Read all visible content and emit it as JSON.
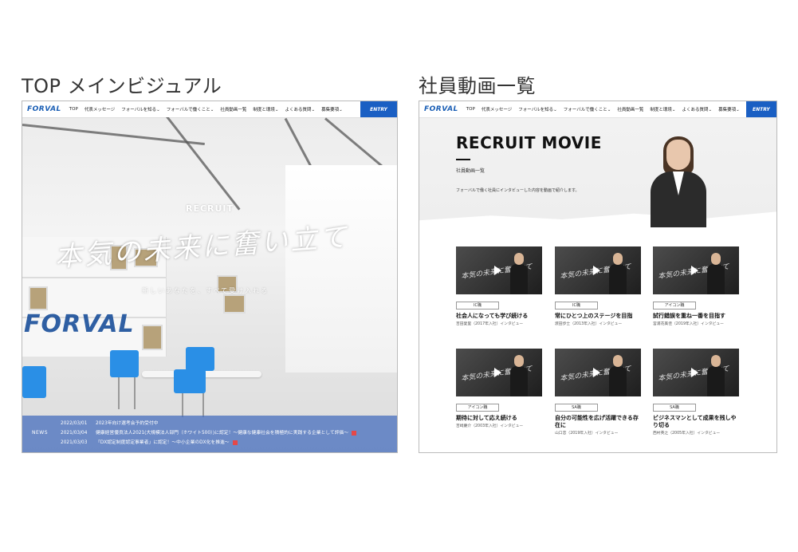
{
  "captions": {
    "left": "TOP メインビジュアル",
    "right": "社員動画一覧"
  },
  "nav": {
    "logo": "FORVAL",
    "items": [
      "TOP",
      "代表メッセージ",
      "フォーバルを知る",
      "フォーバルで働くこと",
      "社員動画一覧",
      "制度と環境",
      "よくある質問",
      "募集要項"
    ],
    "items_right": [
      "TOP",
      "代表メッセージ",
      "フォーバルを知る",
      "フォーバルで働くこと",
      "社員動画一覧",
      "制度と環境",
      "よくある質問",
      "募集要項"
    ],
    "entry": "ENTRY"
  },
  "hero": {
    "title": "RECRUIT",
    "slogan": "本気の未来に奮い立て",
    "sub": "新しいあなたを、すべて受け入れる",
    "wall_logo": "FORVAL"
  },
  "news": {
    "label": "NEWS",
    "items": [
      {
        "date": "2022/03/01",
        "text": "2023年向け選考会予約受付中",
        "pdf": false
      },
      {
        "date": "2021/03/04",
        "text": "健康経営優良法人2021(大規模法人部門（ホワイト500）)に認定！～健康な健康社会を積極的に実践する企業として評価～",
        "pdf": true
      },
      {
        "date": "2021/03/03",
        "text": "「DX認定制度認定事業者」に認定！～中小企業のDX化を推進～",
        "pdf": true
      }
    ]
  },
  "movie": {
    "title": "RECRUIT MOVIE",
    "subtitle": "社員動画一覧",
    "description": "フォーバルで働く社員にインタビューした内容を動画で紹介します。",
    "cards": [
      {
        "tag": "IC職",
        "title": "社会人になっても学び続ける",
        "meta": "吉田愛里（2017年入社）インタビュー",
        "thumb_text": "本気の未来に奮い立て"
      },
      {
        "tag": "IC職",
        "title": "常にひとつ上のステージを目指",
        "meta": "渡田歩士（2013年入社）インタビュー",
        "thumb_text": "本気の未来に奮い立て"
      },
      {
        "tag": "アイコン職",
        "title": "試行錯誤を重ね一番を目指す",
        "meta": "宮浦花美佳（2019年入社）インタビュー",
        "thumb_text": "本気の未来に奮い立て"
      },
      {
        "tag": "アイコン職",
        "title": "期待に対して応え続ける",
        "meta": "吉崎慶介（2003年入社）インタビュー",
        "thumb_text": "本気の未来に奮い立て"
      },
      {
        "tag": "SA職",
        "title": "自分の可能性を広げ活躍できる存在に",
        "meta": "山口恋（2019年入社）インタビュー",
        "thumb_text": "本気の未来に奮い立て"
      },
      {
        "tag": "SA職",
        "title": "ビジネスマンとして成果を残しやり切る",
        "meta": "西村英之（2005年入社）インタビュー",
        "thumb_text": "本気の未来に奮い立て"
      }
    ]
  }
}
